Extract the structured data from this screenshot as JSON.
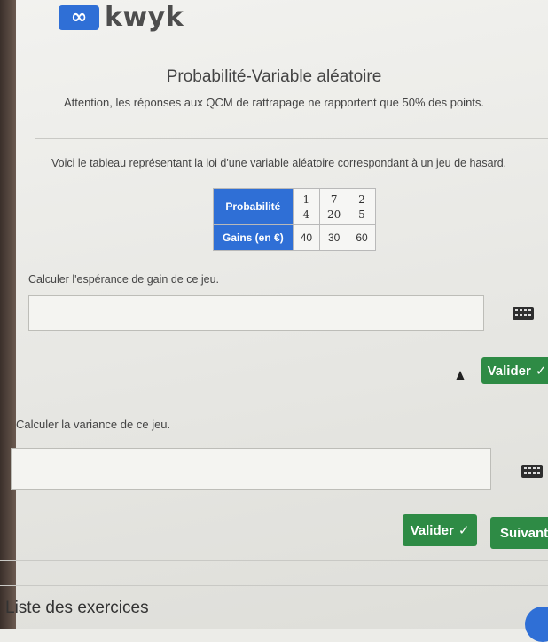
{
  "header": {
    "logo_symbol": "∞",
    "logo_text": "kwyk"
  },
  "page": {
    "title": "Probabilité-Variable aléatoire",
    "warning": "Attention, les réponses aux QCM de rattrapage ne rapportent que 50% des points."
  },
  "exercise": {
    "intro": "Voici le tableau représentant la loi d'une variable aléatoire correspondant à un jeu de hasard.",
    "table": {
      "row1_header": "Probabilité",
      "row2_header": "Gains (en €)",
      "probabilities": [
        {
          "num": "1",
          "den": "4"
        },
        {
          "num": "7",
          "den": "20"
        },
        {
          "num": "2",
          "den": "5"
        }
      ],
      "gains": [
        "40",
        "30",
        "60"
      ]
    },
    "question1": "Calculer l'espérance de gain de ce jeu.",
    "question2": "Calculer la variance de ce jeu.",
    "answer1_value": "",
    "answer2_value": ""
  },
  "buttons": {
    "validate_label": "Valider",
    "check_icon": "✓",
    "next_label": "Suivant"
  },
  "footer": {
    "section_title": "Liste des exercices"
  },
  "colors": {
    "accent": "#2f6fd6",
    "validate": "#2e8b45"
  }
}
